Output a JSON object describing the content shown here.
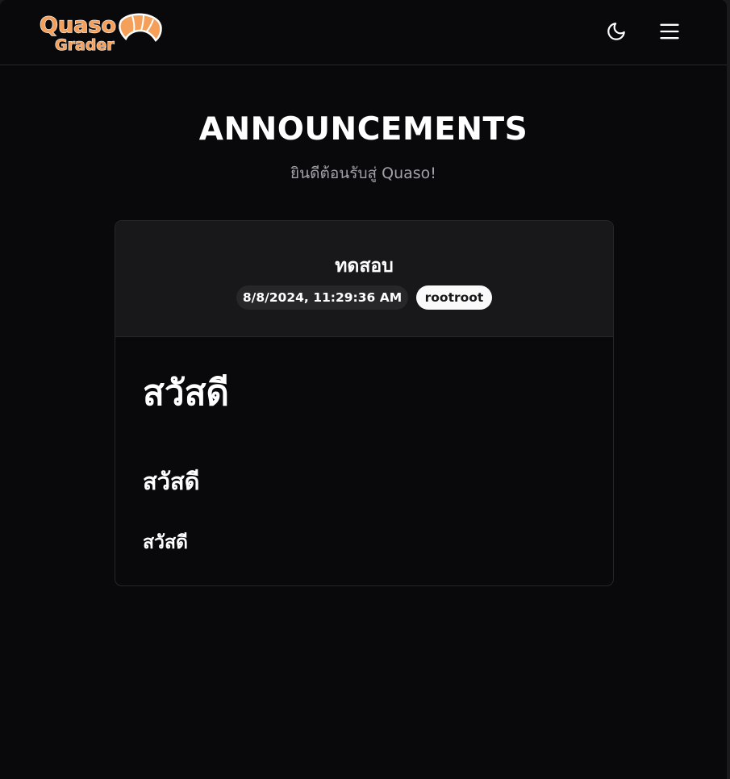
{
  "navbar": {
    "logo_line1": "Quaso",
    "logo_line2": "Grader",
    "theme_icon": "moon-icon",
    "menu_icon": "hamburger-menu-icon"
  },
  "page": {
    "title": "ANNOUNCEMENTS",
    "subtitle": "ยินดีต้อนรับสู่ Quaso!"
  },
  "announcement": {
    "title": "ทดสอบ",
    "date": "8/8/2024, 11:29:36 AM",
    "author": "rootroot",
    "content": {
      "heading1": "สวัสดี",
      "heading2": "สวัสดี",
      "heading3": "สวัสดี"
    }
  },
  "colors": {
    "background": "#09090b",
    "header_bg": "#18181b",
    "border": "#27272a",
    "logo_orange": "#f4a05a",
    "subtitle_gray": "#a1a1aa"
  }
}
